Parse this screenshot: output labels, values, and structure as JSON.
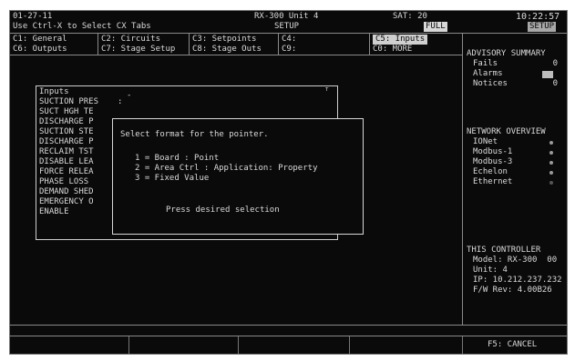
{
  "header": {
    "datetime": "01-27-11",
    "hint": "Use Ctrl-X to Select CX Tabs",
    "unit": "RX-300 Unit 4",
    "mode": "SETUP",
    "sat": "SAT: 20",
    "sat_badge": "FULL",
    "time": "10:22:57",
    "setup_badge": "SETUP"
  },
  "tabs": {
    "row1": [
      "C1: General",
      "C2: Circuits",
      "C3: Setpoints",
      "C4:",
      "C5: Inputs"
    ],
    "row2": [
      "C6: Outputs",
      "C7: Stage Setup",
      "C8: Stage Outs",
      "C9:",
      "C0: MORE"
    ]
  },
  "inputs_panel": {
    "title": "Inputs",
    "rows": [
      "SUCTION PRES",
      "SUCT HGH TE",
      "DISCHARGE P",
      "SUCTION STE",
      "DISCHARGE P",
      "RECLAIM TST",
      "DISABLE LEA",
      "FORCE RELEA",
      "PHASE LOSS",
      "DEMAND SHED",
      "EMERGENCY O",
      "ENABLE"
    ]
  },
  "dialog": {
    "title": "Select format for the pointer.",
    "options": [
      "1 = Board : Point",
      "2 = Area Ctrl : Application: Property",
      "3 = Fixed Value"
    ],
    "prompt": "Press desired selection"
  },
  "advisory": {
    "title": "ADVISORY SUMMARY",
    "fails_label": "Fails",
    "fails_value": "0",
    "alarms_label": "Alarms",
    "notices_label": "Notices",
    "notices_value": "0"
  },
  "network": {
    "title": "NETWORK OVERVIEW",
    "items": [
      "IONet",
      "Modbus-1",
      "Modbus-3",
      "Echelon",
      "Ethernet"
    ]
  },
  "controller": {
    "title": "THIS CONTROLLER",
    "model": "Model: RX-300  00",
    "unit": "Unit: 4",
    "ip": "IP: 10.212.237.232",
    "fw": "F/W Rev: 4.00B26"
  },
  "function_keys": {
    "f5": "F5: CANCEL"
  },
  "colors": {
    "background": "#0a0a0a",
    "text": "#d9d9d9",
    "highlight": "#cfcfcf"
  }
}
